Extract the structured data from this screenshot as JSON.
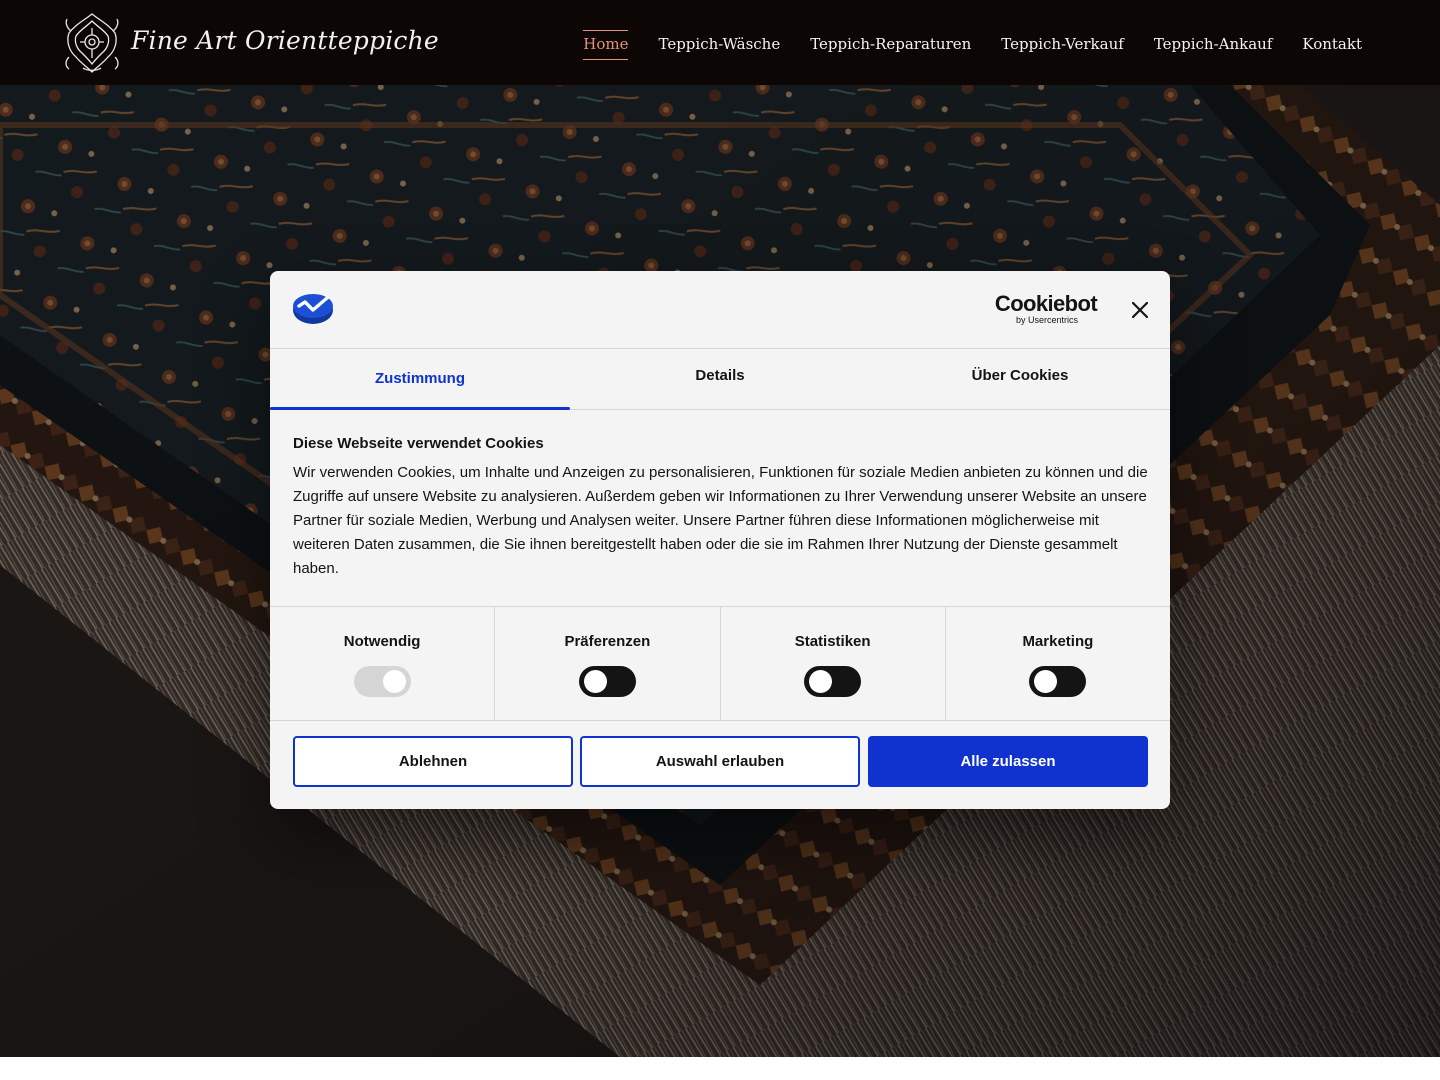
{
  "site": {
    "logo_text": "Fine Art Orientteppiche",
    "nav": [
      {
        "label": "Home",
        "active": true
      },
      {
        "label": "Teppich-Wäsche"
      },
      {
        "label": "Teppich-Reparaturen"
      },
      {
        "label": "Teppich-Verkauf"
      },
      {
        "label": "Teppich-Ankauf"
      },
      {
        "label": "Kontakt"
      }
    ]
  },
  "cookie_dialog": {
    "provider_logo": {
      "word": "Cookiebot",
      "sub": "by Usercentrics"
    },
    "tabs": [
      {
        "label": "Zustimmung",
        "active": true
      },
      {
        "label": "Details"
      },
      {
        "label": "Über Cookies"
      }
    ],
    "title": "Diese Webseite verwendet Cookies",
    "text": "Wir verwenden Cookies, um Inhalte und Anzeigen zu personalisieren, Funktionen für soziale Medien anbieten zu können und die Zugriffe auf unsere Website zu analysieren. Außerdem geben wir Informationen zu Ihrer Verwendung unserer Website an unsere Partner für soziale Medien, Werbung und Analysen weiter. Unsere Partner führen diese Informationen möglicherweise mit weiteren Daten zusammen, die Sie ihnen bereitgestellt haben oder die sie im Rahmen Ihrer Nutzung der Dienste gesammelt haben.",
    "toggles": [
      {
        "label": "Notwendig",
        "on": true,
        "disabled": true
      },
      {
        "label": "Präferenzen",
        "on": false
      },
      {
        "label": "Statistiken",
        "on": false
      },
      {
        "label": "Marketing",
        "on": false
      }
    ],
    "buttons": {
      "reject": "Ablehnen",
      "allow_selection": "Auswahl erlauben",
      "allow_all": "Alle zulassen"
    }
  },
  "colors": {
    "accent": "#1032cf",
    "nav_active": "#e8917a",
    "header_bg": "#0c0605"
  },
  "icons": {
    "close": "close-icon",
    "brand": "cookie-consent-logo-icon",
    "emblem": "ornament-emblem-icon"
  }
}
